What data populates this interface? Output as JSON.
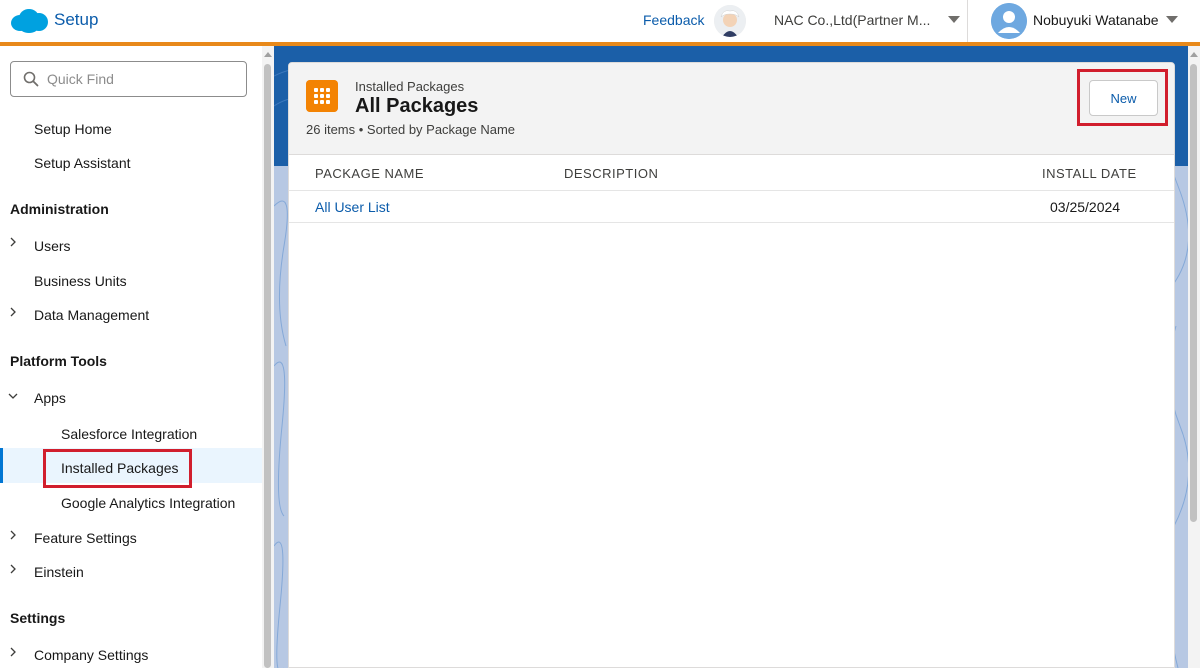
{
  "header": {
    "app_name": "Setup",
    "feedback_label": "Feedback",
    "org_name": "NAC Co.,Ltd(Partner M...",
    "user_name": "Nobuyuki Watanabe"
  },
  "sidebar": {
    "quick_find_placeholder": "Quick Find",
    "top_items": [
      "Setup Home",
      "Setup Assistant"
    ],
    "sections": {
      "administration": "Administration",
      "platform_tools": "Platform Tools",
      "settings": "Settings"
    },
    "admin_items": [
      "Users",
      "Business Units",
      "Data Management"
    ],
    "apps_label": "Apps",
    "apps_children": [
      "Salesforce Integration",
      "Installed Packages",
      "Google Analytics Integration"
    ],
    "platform_items": [
      "Feature Settings",
      "Einstein"
    ],
    "settings_items": [
      "Company Settings"
    ]
  },
  "page": {
    "eyebrow": "Installed Packages",
    "title": "All Packages",
    "meta": "26 items • Sorted by Package Name",
    "new_button": "New"
  },
  "table": {
    "columns": [
      "PACKAGE NAME",
      "DESCRIPTION",
      "INSTALL DATE"
    ],
    "rows": [
      {
        "package_name": "All User List",
        "description": "",
        "install_date": "03/25/2024"
      }
    ]
  },
  "colors": {
    "brand_blue": "#0b5cab",
    "header_accent": "#e8891a",
    "package_icon": "#f38303",
    "highlight_red": "#d11e2d"
  },
  "icons": [
    "salesforce-cloud-icon",
    "einstein-avatar-icon",
    "user-avatar-icon",
    "search-icon",
    "chevron-right-icon",
    "chevron-down-icon",
    "app-grid-icon"
  ]
}
